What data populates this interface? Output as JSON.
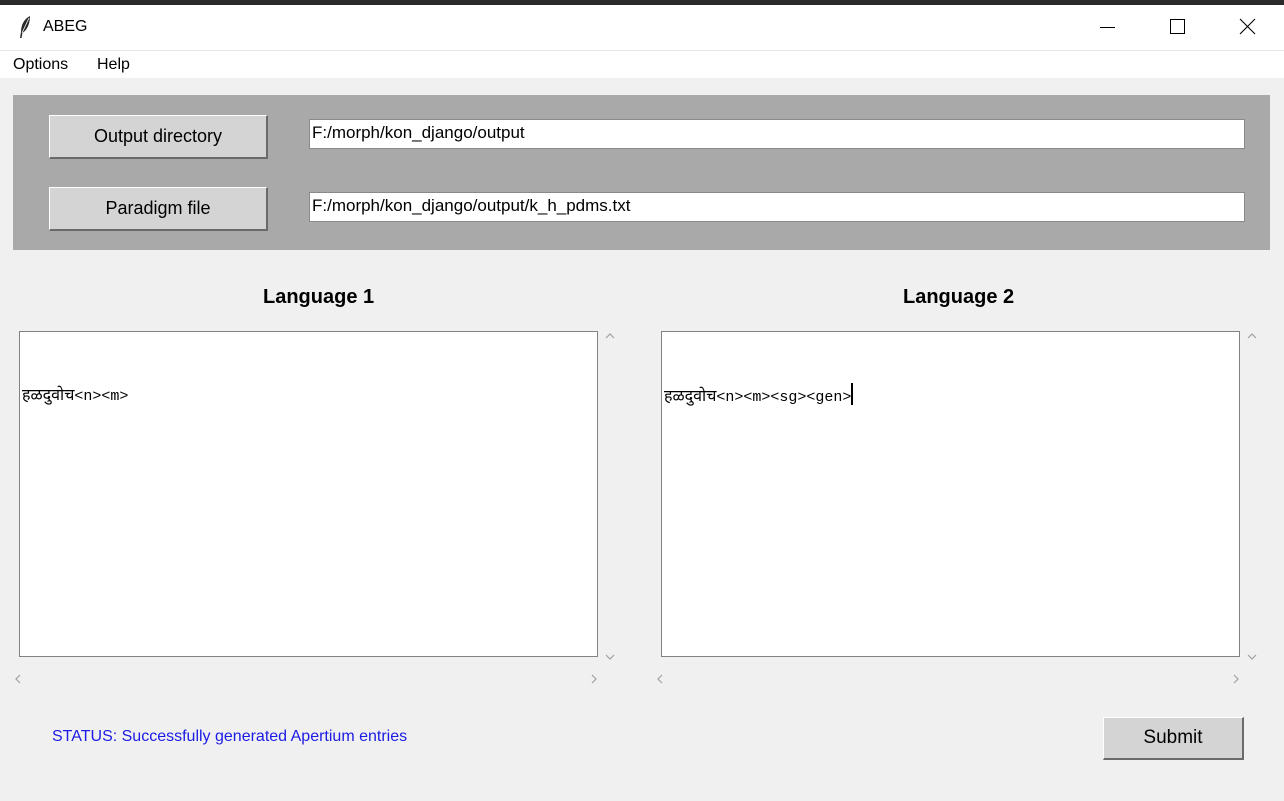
{
  "window": {
    "title": "ABEG",
    "icon": "feather-icon"
  },
  "menubar": {
    "options_label": "Options",
    "help_label": "Help"
  },
  "config": {
    "output_button_label": "Output directory",
    "output_path": "F:/morph/kon_django/output",
    "paradigm_button_label": "Paradigm file",
    "paradigm_path": "F:/morph/kon_django/output/k_h_pdms.txt"
  },
  "language1": {
    "label": "Language 1",
    "word": "हळदुवोच",
    "tags": "<n><m>"
  },
  "language2": {
    "label": "Language 2",
    "word": "हळदुवोच",
    "tags": "<n><m><sg><gen>"
  },
  "status": {
    "text": "STATUS:  Successfully generated Apertium entries",
    "color": "#1b1be6"
  },
  "submit_label": "Submit",
  "colors": {
    "panel_bg": "#a9a9a9",
    "window_bg": "#f0f0f0",
    "button_bg": "#d4d4d4"
  }
}
